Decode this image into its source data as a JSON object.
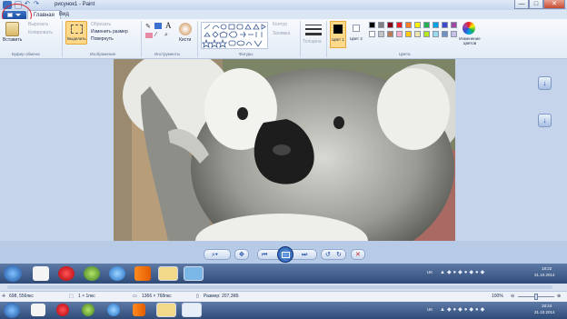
{
  "window": {
    "title": "рисунок1 - Paint",
    "controls": {
      "minimize": "—",
      "maximize": "□",
      "close": "✕"
    }
  },
  "tabs": {
    "home": "Главная",
    "view": "Вид"
  },
  "ribbon": {
    "clipboard": {
      "paste": "Вставить",
      "cut": "Вырезать",
      "copy": "Копировать",
      "group": "Буфер обмена"
    },
    "image": {
      "select": "Выделить",
      "crop": "Обрезать",
      "resize": "Изменить размер",
      "rotate": "Повернуть",
      "group": "Изображение"
    },
    "tools": {
      "brushes": "Кисти",
      "group": "Инструменты"
    },
    "shapes": {
      "outline": "Контур",
      "fill": "Заливка",
      "group": "Фигуры"
    },
    "size": {
      "label": "Толщина"
    },
    "colors": {
      "color1": "Цвет 1",
      "color2": "Цвет 2",
      "edit": "Изменение цветов",
      "group": "Цвета",
      "palette": [
        "#000000",
        "#7f7f7f",
        "#880015",
        "#ed1c24",
        "#ff7f27",
        "#fff200",
        "#22b14c",
        "#00a2e8",
        "#3f48cc",
        "#a349a4",
        "#ffffff",
        "#c3c3c3",
        "#b97a57",
        "#ffaec9",
        "#ffc90e",
        "#efe4b0",
        "#b5e61d",
        "#99d9ea",
        "#7092be",
        "#c8bfe7"
      ]
    }
  },
  "taskbar_top": {
    "lang": "UK",
    "time": "18:22",
    "date": "31.10.2014"
  },
  "status": {
    "position": "698, 556пкс",
    "selection": "1 × 1пкс",
    "dimensions": "1366 × 768пкс",
    "filesize": "Размер: 207,3КБ",
    "zoom": "100%"
  },
  "taskbar_bottom": {
    "lang": "UK",
    "time": "18:24",
    "date": "31.10.2014"
  },
  "colors": {
    "accent": "#1c4ea3",
    "highlight": "#d9232c"
  }
}
